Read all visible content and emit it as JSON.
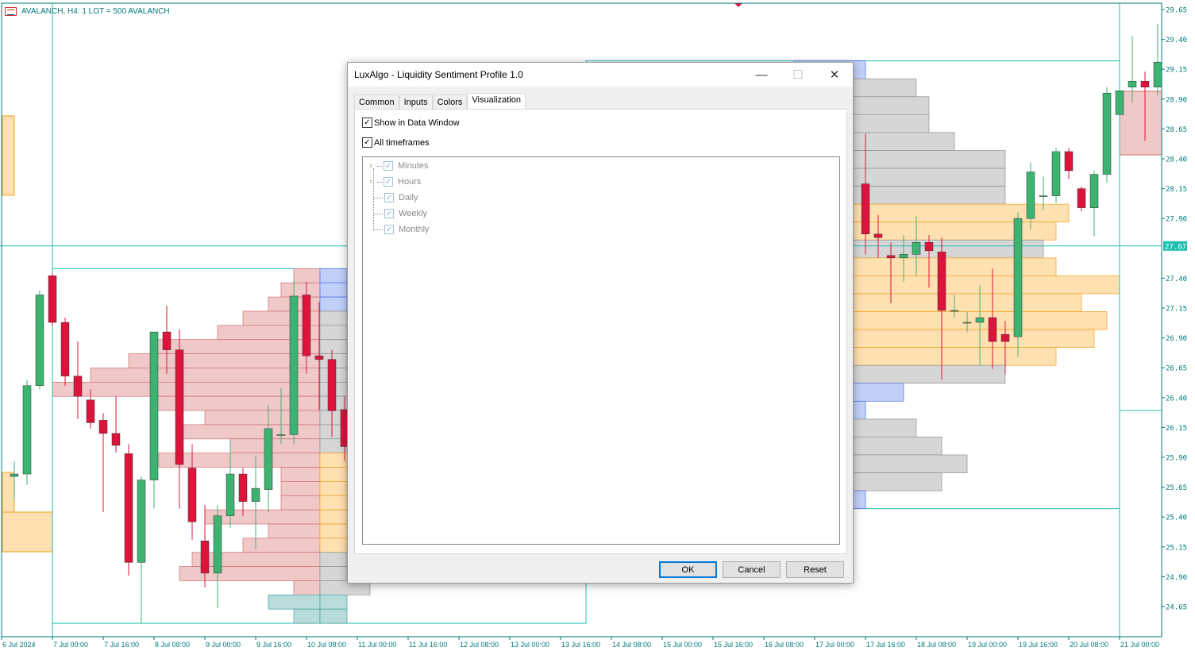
{
  "chart": {
    "symbol_label": "AVALANCH, H4:  1 LOT = 500 AVALANCH",
    "current_price": "27.67",
    "price_ticks": [
      "29.65",
      "29.40",
      "29.15",
      "28.90",
      "28.65",
      "28.40",
      "28.15",
      "27.90",
      "27.40",
      "27.15",
      "26.90",
      "26.65",
      "26.40",
      "26.15",
      "25.90",
      "25.65",
      "25.40",
      "25.15",
      "24.90",
      "24.65"
    ],
    "time_labels": [
      "6 Jul 2024",
      "7 Jul 00:00",
      "7 Jul 16:00",
      "8 Jul 08:00",
      "9 Jul 00:00",
      "9 Jul 16:00",
      "10 Jul 08:00",
      "11 Jul 00:00",
      "11 Jul 16:00",
      "12 Jul 08:00",
      "13 Jul 00:00",
      "13 Jul 16:00",
      "14 Jul 08:00",
      "15 Jul 00:00",
      "15 Jul 16:00",
      "16 Jul 08:00",
      "17 Jul 00:00",
      "17 Jul 16:00",
      "18 Jul 08:00",
      "19 Jul 00:00",
      "19 Jul 16:00",
      "20 Jul 08:00",
      "21 Jul 00:00"
    ],
    "colors": {
      "bull": "#3cb371",
      "bear": "#dc143c",
      "line": "#20c0b0",
      "axis": "#007a7a",
      "sell": "#f0c8c8",
      "buy": "#c0d0f8",
      "neutral": "#d6d6d6",
      "hv": "#ffe0b0",
      "low": "#b8dcdc"
    },
    "candles_left_start_bar": 1,
    "candles_left": [
      [
        25.74,
        25.87,
        25.54,
        25.76
      ],
      [
        25.76,
        26.55,
        25.67,
        26.5
      ],
      [
        26.5,
        27.3,
        26.47,
        27.26
      ],
      [
        27.42,
        27.44,
        27.0,
        27.03
      ],
      [
        27.03,
        27.07,
        26.5,
        26.58
      ],
      [
        26.58,
        26.87,
        26.22,
        26.41
      ],
      [
        26.38,
        26.47,
        26.14,
        26.19
      ],
      [
        26.21,
        26.27,
        25.44,
        26.1
      ],
      [
        26.1,
        26.41,
        25.94,
        26.0
      ],
      [
        25.93,
        26.01,
        24.91,
        25.02
      ],
      [
        25.02,
        25.74,
        24.51,
        25.71
      ],
      [
        25.71,
        26.95,
        25.47,
        26.95
      ],
      [
        26.95,
        27.17,
        26.6,
        26.8
      ],
      [
        26.8,
        26.97,
        25.47,
        25.84
      ],
      [
        25.81,
        26.01,
        25.21,
        25.36
      ],
      [
        25.2,
        25.5,
        24.81,
        24.93
      ],
      [
        24.93,
        25.5,
        24.64,
        25.41
      ],
      [
        25.41,
        26.04,
        25.31,
        25.76
      ],
      [
        25.76,
        25.81,
        25.41,
        25.53
      ],
      [
        25.53,
        25.91,
        25.13,
        25.64
      ],
      [
        25.63,
        26.34,
        25.44,
        26.14
      ],
      [
        26.09,
        26.48,
        26.01,
        26.09
      ],
      [
        26.09,
        27.39,
        26.01,
        27.25
      ],
      [
        27.26,
        27.37,
        26.6,
        26.75
      ],
      [
        26.75,
        27.2,
        26.3,
        26.72
      ],
      [
        26.72,
        26.8,
        26.07,
        26.29
      ],
      [
        26.3,
        26.41,
        25.87,
        25.99
      ]
    ],
    "candles_right_start_bar": 68,
    "candles_right": [
      [
        28.19,
        28.61,
        27.6,
        27.77
      ],
      [
        27.77,
        27.93,
        27.57,
        27.74
      ],
      [
        27.59,
        27.7,
        27.19,
        27.57
      ],
      [
        27.57,
        27.76,
        27.37,
        27.6
      ],
      [
        27.6,
        27.92,
        27.42,
        27.7
      ],
      [
        27.7,
        27.76,
        27.32,
        27.63
      ],
      [
        27.62,
        27.74,
        26.55,
        27.13
      ],
      [
        27.13,
        27.26,
        27.07,
        27.13
      ],
      [
        27.03,
        27.12,
        26.95,
        27.03
      ],
      [
        27.03,
        27.34,
        26.67,
        27.07
      ],
      [
        27.07,
        27.48,
        26.64,
        26.87
      ],
      [
        26.93,
        27.04,
        26.6,
        26.87
      ],
      [
        26.91,
        27.95,
        26.74,
        27.9
      ],
      [
        27.9,
        28.37,
        27.81,
        28.29
      ],
      [
        28.09,
        28.25,
        27.97,
        28.09
      ],
      [
        28.09,
        28.49,
        28.03,
        28.46
      ],
      [
        28.46,
        28.49,
        28.23,
        28.3
      ],
      [
        28.15,
        28.17,
        27.96,
        27.99
      ],
      [
        27.99,
        28.3,
        27.75,
        28.27
      ],
      [
        28.27,
        29.0,
        28.2,
        28.95
      ],
      [
        28.77,
        29.0,
        28.77,
        28.97
      ],
      [
        29.0,
        29.43,
        28.87,
        29.05
      ],
      [
        29.05,
        29.13,
        28.55,
        29.0
      ],
      [
        29.0,
        29.53,
        28.93,
        29.21
      ]
    ],
    "profile_left": {
      "top": 27.48,
      "bottom": 24.51,
      "sell": [
        33,
        49,
        65,
        97,
        129,
        209,
        241,
        289,
        337,
        209,
        145,
        177,
        113,
        203,
        49,
        49,
        49,
        145,
        65,
        97,
        161,
        177,
        33,
        65,
        33
      ],
      "side": [
        "buy",
        "buy",
        "buy",
        "neutral",
        "neutral",
        "neutral",
        "neutral",
        "neutral",
        "neutral",
        "neutral",
        "neutral",
        "neutral",
        "neutral",
        "hv",
        "hv",
        "hv",
        "hv",
        "hv",
        "hv",
        "hv",
        "neutral",
        "neutral",
        "neutral",
        "low",
        "low"
      ]
    },
    "profile_right": {
      "top": 29.22,
      "bottom": 25.47,
      "ext": [
        15,
        79,
        95,
        95,
        127,
        191,
        191,
        191,
        271,
        255,
        239,
        255,
        335,
        287,
        319,
        303,
        255,
        191,
        63,
        15,
        79,
        111,
        143,
        111,
        15
      ],
      "side": [
        "buy",
        "neutral",
        "neutral",
        "neutral",
        "neutral",
        "neutral",
        "neutral",
        "neutral",
        "hv",
        "hv",
        "neutral",
        "hv",
        "hv",
        "hv",
        "hv",
        "hv",
        "hv",
        "neutral",
        "buy",
        "buy",
        "neutral",
        "neutral",
        "neutral",
        "neutral",
        "buy"
      ]
    }
  },
  "dialog": {
    "title": "LuxAlgo - Liquidity Sentiment Profile 1.0",
    "tabs": [
      "Common",
      "Inputs",
      "Colors",
      "Visualization"
    ],
    "show_in_data_window": "Show in Data Window",
    "all_timeframes": "All timeframes",
    "timeframes": [
      "Minutes",
      "Hours",
      "Daily",
      "Weekly",
      "Monthly"
    ],
    "ok": "OK",
    "cancel": "Cancel",
    "reset": "Reset",
    "check": "✓",
    "minimize": "—",
    "maximize": "☐",
    "close": "✕"
  }
}
